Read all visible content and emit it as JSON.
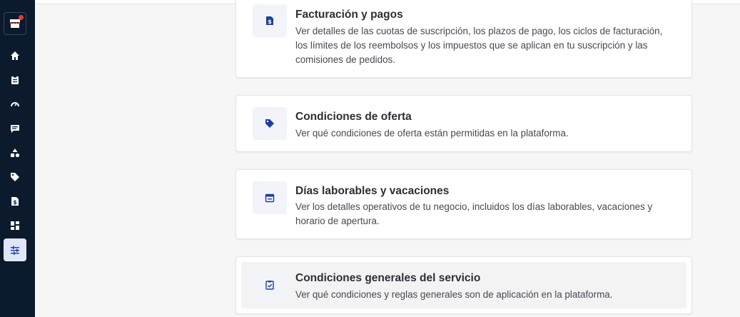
{
  "sidebar": {
    "store_icon": "store-icon",
    "items": [
      {
        "icon": "home-icon",
        "label": "home"
      },
      {
        "icon": "clipboard-icon",
        "label": "orders"
      },
      {
        "icon": "gauge-icon",
        "label": "performance"
      },
      {
        "icon": "chat-icon",
        "label": "messages"
      },
      {
        "icon": "shapes-icon",
        "label": "catalog"
      },
      {
        "icon": "tag-icon",
        "label": "offers"
      },
      {
        "icon": "invoice-icon",
        "label": "billing"
      },
      {
        "icon": "dashboard-icon",
        "label": "apps"
      },
      {
        "icon": "sliders-icon",
        "label": "settings",
        "active": true
      }
    ]
  },
  "cards": [
    {
      "icon": "invoice-icon",
      "title": "Facturación y pagos",
      "description": "Ver detalles de las cuotas de suscripción, los plazos de pago, los ciclos de facturación, los límites de los reembolsos y los impuestos que se aplican en tu suscripción y las comisiones de pedidos."
    },
    {
      "icon": "tag-icon",
      "title": "Condiciones de oferta",
      "description": "Ver qué condiciones de oferta están permitidas en la plataforma."
    },
    {
      "icon": "calendar-icon",
      "title": "Días laborables y vacaciones",
      "description": "Ver los detalles operativos de tu negocio, incluidos los días laborables, vacaciones y horario de apertura."
    },
    {
      "icon": "clipboard-check-icon",
      "title": "Condiciones generales del servicio",
      "description": "Ver qué condiciones y reglas generales son de aplicación en la plataforma."
    }
  ],
  "colors": {
    "sidebar_bg": "#0b1a2d",
    "accent": "#1a3ea8",
    "notification": "#e53935"
  }
}
